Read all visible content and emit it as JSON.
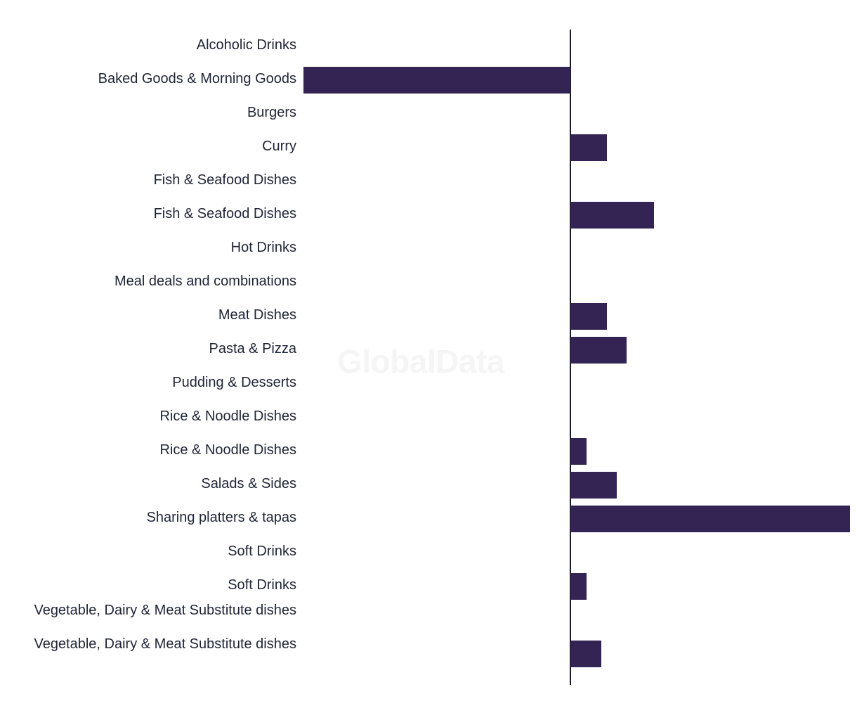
{
  "watermark": {
    "text": "GlobalData"
  },
  "chart_data": {
    "type": "bar",
    "orientation": "horizontal",
    "title": "",
    "subtitle": "",
    "xlabel": "",
    "ylabel": "",
    "grid": false,
    "legend": "none",
    "zero_line": true,
    "axis_ticks_visible": false,
    "xlim": [
      -10.2,
      10.7
    ],
    "bar_color": "#342454",
    "label_color": "#1f2436",
    "axis_color": "#151a2d",
    "categories": [
      "Alcoholic Drinks",
      "Baked Goods & Morning Goods",
      "Burgers",
      "Curry",
      "Fish & Seafood Dishes",
      "Fish & Seafood Dishes",
      "Hot Drinks",
      "Meal deals and combinations",
      "Meat Dishes",
      "Pasta & Pizza",
      "Pudding & Desserts",
      "Rice & Noodle Dishes",
      "Rice & Noodle Dishes",
      "Salads & Sides",
      "Sharing platters & tapas",
      "Soft Drinks",
      "Soft Drinks",
      "Vegetable, Dairy & Meat Substitute dishes",
      "Vegetable, Dairy & Meat Substitute dishes"
    ],
    "values": [
      0.0,
      -9.55,
      0.0,
      1.31,
      0.0,
      2.99,
      0.0,
      0.0,
      1.31,
      2.01,
      0.0,
      0.0,
      0.58,
      1.66,
      10.0,
      0.0,
      0.58,
      0.0,
      1.11
    ]
  },
  "rows": [
    {
      "label": "Alcoholic Drinks",
      "value": 0.0,
      "lines": 1
    },
    {
      "label": "Baked Goods & Morning Goods",
      "value": -9.55,
      "lines": 1
    },
    {
      "label": "Burgers",
      "value": 0.0,
      "lines": 1
    },
    {
      "label": "Curry",
      "value": 1.31,
      "lines": 1
    },
    {
      "label": "Fish & Seafood Dishes",
      "value": 0.0,
      "lines": 1
    },
    {
      "label": "Fish & Seafood Dishes",
      "value": 2.99,
      "lines": 1
    },
    {
      "label": "Hot Drinks",
      "value": 0.0,
      "lines": 1
    },
    {
      "label": "Meal deals and combinations",
      "value": 0.0,
      "lines": 1
    },
    {
      "label": "Meat Dishes",
      "value": 1.31,
      "lines": 1
    },
    {
      "label": "Pasta & Pizza",
      "value": 2.01,
      "lines": 1
    },
    {
      "label": "Pudding & Desserts",
      "value": 0.0,
      "lines": 1
    },
    {
      "label": "Rice & Noodle Dishes",
      "value": 0.0,
      "lines": 1
    },
    {
      "label": "Rice & Noodle Dishes",
      "value": 0.58,
      "lines": 1
    },
    {
      "label": "Salads & Sides",
      "value": 1.66,
      "lines": 1
    },
    {
      "label": "Sharing platters & tapas",
      "value": 10.0,
      "lines": 1
    },
    {
      "label": "Soft Drinks",
      "value": 0.0,
      "lines": 1
    },
    {
      "label": "Soft Drinks",
      "value": 0.58,
      "lines": 1
    },
    {
      "label": "Vegetable, Dairy & Meat Substitute dishes",
      "value": 0.0,
      "lines": 2
    },
    {
      "label": "Vegetable, Dairy & Meat Substitute dishes",
      "value": 1.11,
      "lines": 2
    }
  ]
}
